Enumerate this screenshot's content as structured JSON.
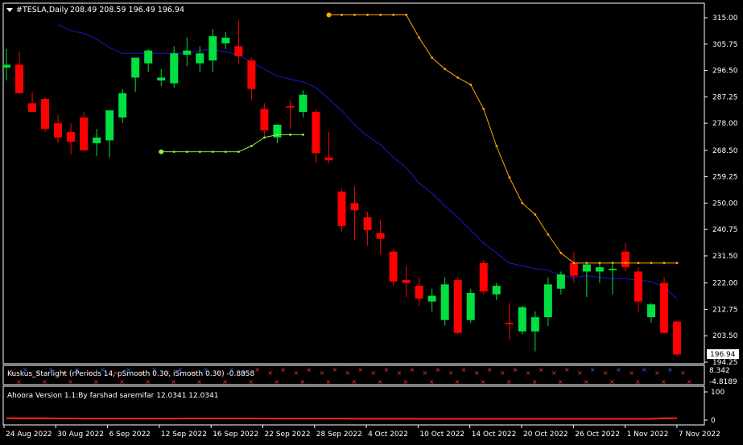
{
  "header": {
    "menu_icon": "triangle-down-icon",
    "symbol": "#TESLA,Daily",
    "ohlc": "208.49 208.59 196.49 196.94"
  },
  "price_axis": {
    "ticks": [
      "315.00",
      "305.75",
      "296.50",
      "287.25",
      "278.00",
      "268.50",
      "259.25",
      "250.00",
      "240.75",
      "231.50",
      "222.00",
      "212.75",
      "203.50",
      "194.25"
    ],
    "current_price": "196.94"
  },
  "time_axis": {
    "labels": [
      "24 Aug 2022",
      "30 Aug 2022",
      "6 Sep 2022",
      "12 Sep 2022",
      "16 Sep 2022",
      "22 Sep 2022",
      "28 Sep 2022",
      "4 Oct 2022",
      "10 Oct 2022",
      "14 Oct 2022",
      "20 Oct 2022",
      "26 Oct 2022",
      "1 Nov 2022",
      "7 Nov 2022"
    ]
  },
  "indicator1": {
    "title": "Kuskus_Starlight (rPeriods 14, pSmooth 0.30, iSmooth 0.30) -0.8858",
    "ticks": [
      "8.342",
      "-4.8189"
    ]
  },
  "indicator2": {
    "title": "Ahoora Version 1.1:By farshad saremifar  12.0341 12.0341",
    "ticks": [
      "100",
      "0"
    ]
  },
  "colors": {
    "bull": "#00e040",
    "bear": "#ff0000",
    "ma": "#1a1acc",
    "orange_line": "#ffa500",
    "green_line": "#90ee40",
    "grid": "#ffffff"
  },
  "chart_data": {
    "type": "candlestick",
    "ylim": [
      194.25,
      315.0
    ],
    "candles": [
      {
        "o": 297.5,
        "h": 304,
        "l": 293,
        "c": 298.5
      },
      {
        "o": 298.5,
        "h": 303,
        "l": 289,
        "c": 288.5
      },
      {
        "o": 285,
        "h": 289,
        "l": 282,
        "c": 282
      },
      {
        "o": 286.5,
        "h": 287,
        "l": 275,
        "c": 276
      },
      {
        "o": 278,
        "h": 281,
        "l": 271,
        "c": 273
      },
      {
        "o": 275,
        "h": 278,
        "l": 267,
        "c": 271.5
      },
      {
        "o": 280,
        "h": 282,
        "l": 271,
        "c": 268.5
      },
      {
        "o": 271,
        "h": 276,
        "l": 266.5,
        "c": 273
      },
      {
        "o": 272,
        "h": 277,
        "l": 266,
        "c": 282.5
      },
      {
        "o": 280,
        "h": 290,
        "l": 278,
        "c": 288.5
      },
      {
        "o": 294,
        "h": 300,
        "l": 289,
        "c": 301
      },
      {
        "o": 299,
        "h": 304,
        "l": 296,
        "c": 303.5
      },
      {
        "o": 293,
        "h": 297,
        "l": 291,
        "c": 294
      },
      {
        "o": 292,
        "h": 305,
        "l": 290.5,
        "c": 302.5
      },
      {
        "o": 302,
        "h": 308,
        "l": 298,
        "c": 303.5
      },
      {
        "o": 299,
        "h": 305,
        "l": 296,
        "c": 302.5
      },
      {
        "o": 300,
        "h": 311,
        "l": 296,
        "c": 308.5
      },
      {
        "o": 306,
        "h": 310,
        "l": 304,
        "c": 308
      },
      {
        "o": 305,
        "h": 314,
        "l": 299,
        "c": 301.5
      },
      {
        "o": 300,
        "h": 301,
        "l": 286,
        "c": 290
      },
      {
        "o": 283,
        "h": 285,
        "l": 273,
        "c": 275.5
      },
      {
        "o": 273,
        "h": 276,
        "l": 271,
        "c": 277.5
      },
      {
        "o": 284,
        "h": 286,
        "l": 276,
        "c": 283.5
      },
      {
        "o": 282,
        "h": 289.5,
        "l": 280,
        "c": 288
      },
      {
        "o": 282,
        "h": 283,
        "l": 264,
        "c": 267.5
      },
      {
        "o": 266,
        "h": 275,
        "l": 264,
        "c": 265
      },
      {
        "o": 254,
        "h": 255,
        "l": 240,
        "c": 242
      },
      {
        "o": 250,
        "h": 256,
        "l": 237,
        "c": 247.5
      },
      {
        "o": 245,
        "h": 247,
        "l": 235,
        "c": 240.5
      },
      {
        "o": 239.5,
        "h": 244,
        "l": 232,
        "c": 237.5
      },
      {
        "o": 233,
        "h": 234,
        "l": 221,
        "c": 222.5
      },
      {
        "o": 223,
        "h": 228,
        "l": 217,
        "c": 222
      },
      {
        "o": 221,
        "h": 224,
        "l": 214,
        "c": 216.5
      },
      {
        "o": 215.5,
        "h": 220,
        "l": 212,
        "c": 217.5
      },
      {
        "o": 209,
        "h": 224,
        "l": 207,
        "c": 221.5
      },
      {
        "o": 223,
        "h": 224,
        "l": 204,
        "c": 204.5
      },
      {
        "o": 209,
        "h": 220,
        "l": 208,
        "c": 218.5
      },
      {
        "o": 229,
        "h": 230,
        "l": 218,
        "c": 219
      },
      {
        "o": 218,
        "h": 222,
        "l": 216,
        "c": 221
      },
      {
        "o": 208,
        "h": 215,
        "l": 202,
        "c": 207.5
      },
      {
        "o": 205,
        "h": 214,
        "l": 204,
        "c": 213.5
      },
      {
        "o": 205,
        "h": 212,
        "l": 198,
        "c": 210
      },
      {
        "o": 210,
        "h": 224,
        "l": 207,
        "c": 221.5
      },
      {
        "o": 220,
        "h": 226,
        "l": 218,
        "c": 225
      },
      {
        "o": 229,
        "h": 233,
        "l": 222,
        "c": 224.5
      },
      {
        "o": 226,
        "h": 229,
        "l": 217,
        "c": 228.5
      },
      {
        "o": 226,
        "h": 229,
        "l": 222,
        "c": 227.5
      },
      {
        "o": 226.5,
        "h": 229.5,
        "l": 218,
        "c": 227
      },
      {
        "o": 233,
        "h": 236,
        "l": 226,
        "c": 227.5
      },
      {
        "o": 226,
        "h": 227.5,
        "l": 212,
        "c": 215.5
      },
      {
        "o": 210,
        "h": 215,
        "l": 208,
        "c": 214.5
      },
      {
        "o": 222,
        "h": 224,
        "l": 204,
        "c": 204.5
      },
      {
        "o": 208.49,
        "h": 208.59,
        "l": 196.49,
        "c": 196.94
      }
    ],
    "ma": [
      null,
      null,
      null,
      null,
      312.5,
      310.5,
      309.5,
      307.5,
      304.5,
      302.5,
      302.5,
      302.5,
      302.5,
      302.5,
      302.5,
      303.5,
      304,
      303,
      302,
      299.5,
      297,
      294.5,
      293.5,
      292.5,
      290.5,
      286.5,
      282.5,
      277.5,
      273.5,
      270.5,
      266,
      262.5,
      257,
      253.5,
      249,
      245,
      240.5,
      236,
      232.5,
      229,
      228,
      227,
      226.5,
      224.5,
      224,
      224.5,
      224,
      223.5,
      223.5,
      223,
      222.5,
      220.5,
      216.5
    ],
    "orange": [
      null,
      null,
      null,
      null,
      null,
      null,
      null,
      null,
      null,
      null,
      null,
      null,
      null,
      null,
      null,
      null,
      null,
      null,
      null,
      null,
      null,
      null,
      null,
      null,
      null,
      316,
      316,
      316,
      316,
      316,
      316,
      316,
      308,
      301,
      297,
      294,
      291.5,
      283,
      270,
      259,
      250,
      246,
      239,
      232.5,
      229,
      229,
      229,
      229,
      229,
      229,
      229,
      229,
      229
    ],
    "green": [
      null,
      null,
      null,
      null,
      null,
      null,
      null,
      null,
      null,
      null,
      null,
      null,
      268,
      268,
      268,
      268,
      268,
      268,
      268,
      270,
      273,
      274,
      274,
      274,
      null,
      null,
      null,
      null,
      null,
      null,
      null,
      null,
      null,
      null,
      null,
      null,
      null,
      null,
      null,
      null,
      null,
      null,
      null,
      null,
      null,
      null,
      null,
      null,
      null,
      null,
      null,
      null,
      null
    ],
    "kuskus_marks": [
      "red",
      "blue",
      "red",
      "blue",
      "red",
      "blue",
      "red",
      "blue",
      "red",
      "blue",
      "red",
      "blue",
      "red",
      "blue",
      "red",
      "blue",
      "red",
      "blue",
      "blue",
      "red",
      "red",
      "red",
      "red",
      "red",
      "red",
      "red",
      "red",
      "red",
      "red",
      "red",
      "red",
      "red",
      "red",
      "red",
      "red",
      "red",
      "red",
      "red",
      "red",
      "red",
      "red",
      "red",
      "red",
      "red",
      "red",
      "blue",
      "red",
      "blue",
      "red",
      "blue",
      "red",
      "blue",
      "red"
    ],
    "ahoora": [
      12,
      12,
      12,
      12,
      11.5,
      11.5,
      11,
      11,
      11,
      11,
      11,
      11,
      11,
      11,
      11.5,
      11.5,
      11.5,
      11.5,
      11.5,
      11.5,
      11,
      11,
      11,
      11,
      11,
      11,
      11,
      10.5,
      10.5,
      10.5,
      10.5,
      10.5,
      10,
      10,
      10,
      10,
      10,
      10,
      10,
      10,
      10,
      10,
      10,
      10,
      10,
      10,
      10,
      10,
      10,
      10,
      10,
      12.03,
      12.03
    ]
  }
}
